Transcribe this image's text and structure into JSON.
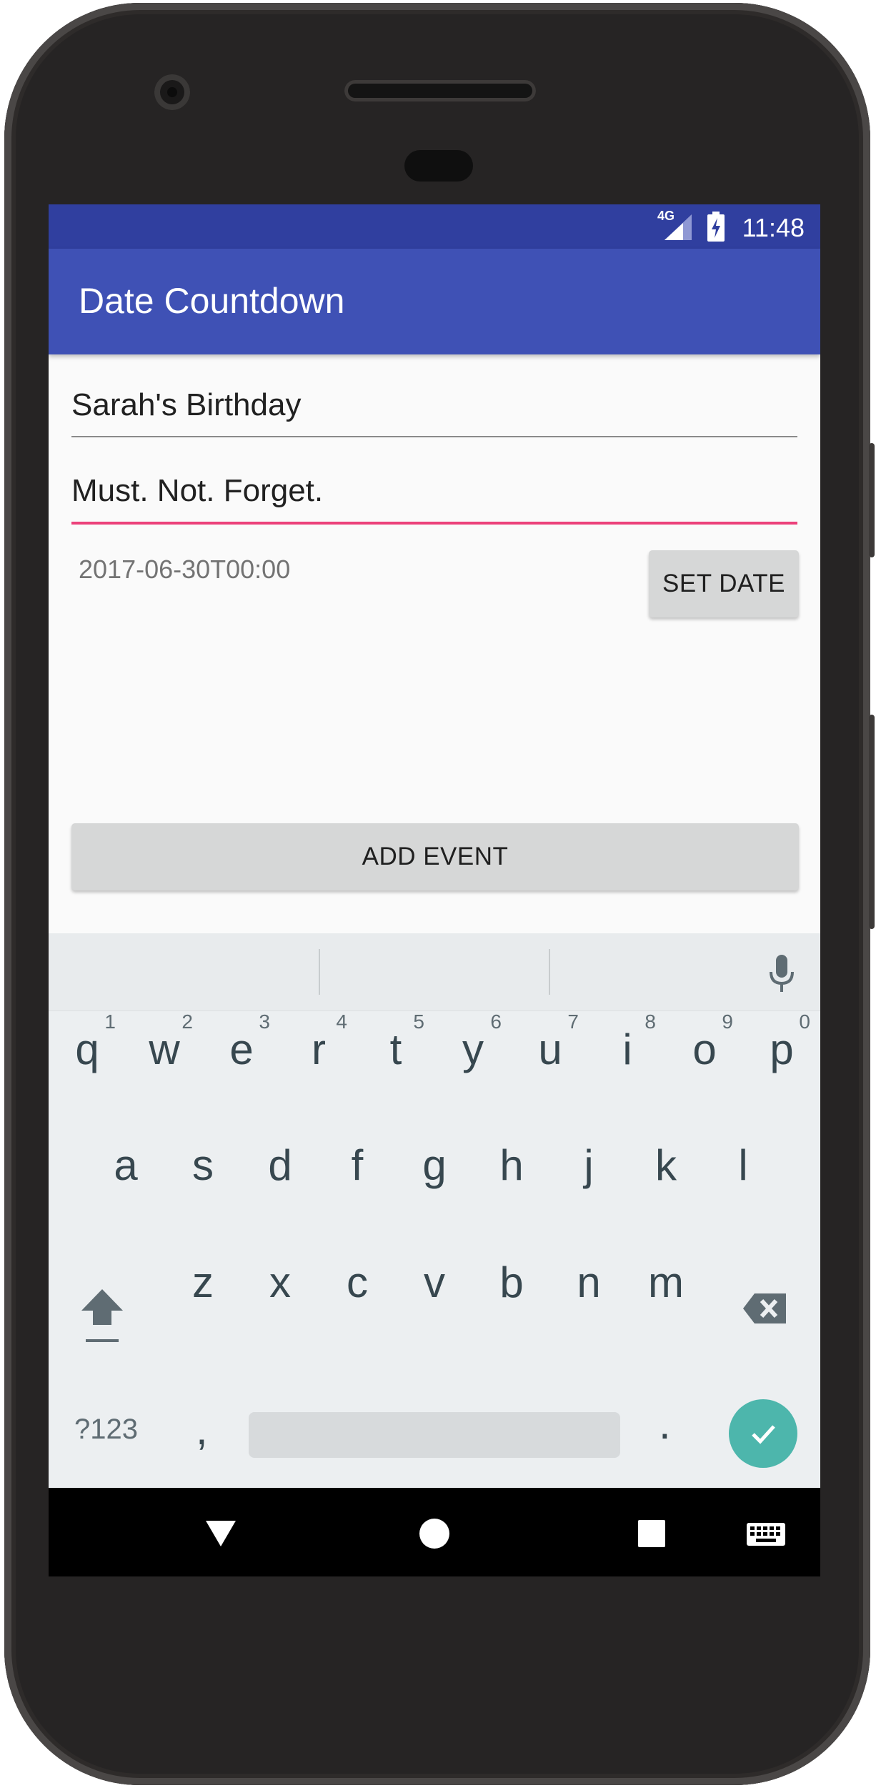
{
  "status_bar": {
    "network": "4G",
    "time": "11:48"
  },
  "app_bar": {
    "title": "Date Countdown"
  },
  "form": {
    "event_name": "Sarah's Birthday",
    "event_note": "Must. Not. Forget.",
    "date_value": "2017-06-30T00:00",
    "set_date_label": "SET DATE",
    "add_event_label": "ADD EVENT"
  },
  "keyboard": {
    "row1": [
      {
        "key": "q",
        "hint": "1"
      },
      {
        "key": "w",
        "hint": "2"
      },
      {
        "key": "e",
        "hint": "3"
      },
      {
        "key": "r",
        "hint": "4"
      },
      {
        "key": "t",
        "hint": "5"
      },
      {
        "key": "y",
        "hint": "6"
      },
      {
        "key": "u",
        "hint": "7"
      },
      {
        "key": "i",
        "hint": "8"
      },
      {
        "key": "o",
        "hint": "9"
      },
      {
        "key": "p",
        "hint": "0"
      }
    ],
    "row2": [
      "a",
      "s",
      "d",
      "f",
      "g",
      "h",
      "j",
      "k",
      "l"
    ],
    "row3": [
      "z",
      "x",
      "c",
      "v",
      "b",
      "n",
      "m"
    ],
    "symbols_label": "?123",
    "comma": ",",
    "period": ".",
    "icons": [
      "mic-icon",
      "shift-icon",
      "backspace-icon",
      "check-icon"
    ]
  },
  "nav_bar": {
    "icons": [
      "back-icon",
      "home-icon",
      "recents-icon",
      "keyboard-icon"
    ]
  },
  "colors": {
    "primary": "#3f51b5",
    "primary_dark": "#303f9f",
    "accent": "#ec407a",
    "enter_key": "#4db6ac"
  }
}
